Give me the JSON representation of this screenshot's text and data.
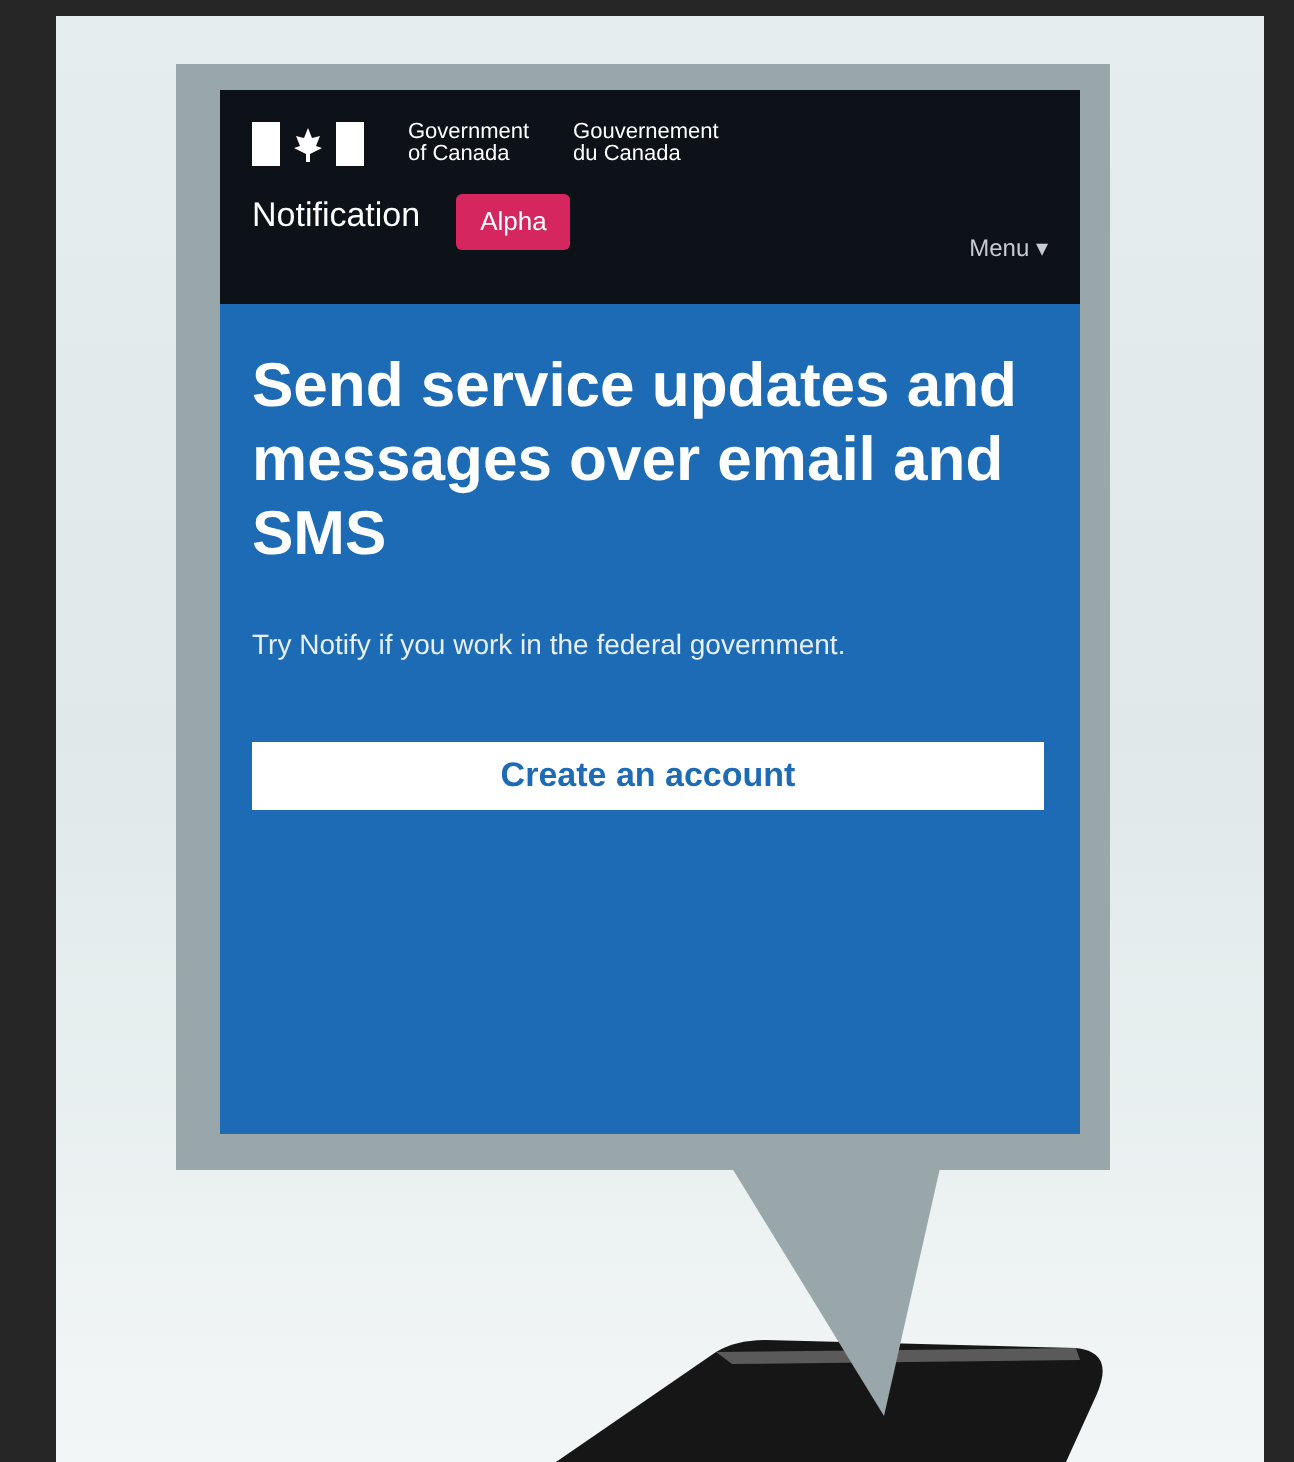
{
  "header": {
    "department_en": [
      "Government",
      "of Canada"
    ],
    "department_fr": [
      "Gouvernement",
      "du Canada"
    ],
    "product": "Notification",
    "badge": "Alpha",
    "menu": "Menu ▾"
  },
  "hero": {
    "title": "Send service updates and messages over email and SMS",
    "text": "Try Notify if you work in the federal government.",
    "button": "Create an account"
  }
}
